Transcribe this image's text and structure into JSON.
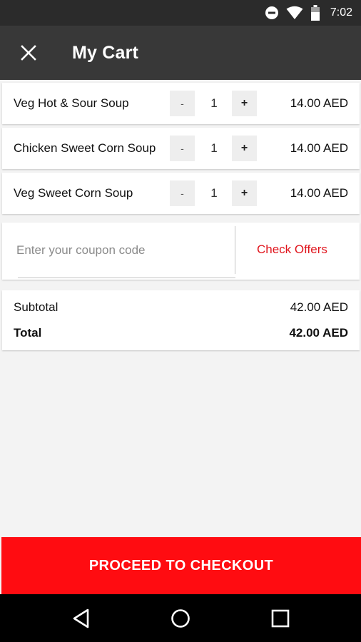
{
  "status_bar": {
    "time": "7:02"
  },
  "header": {
    "title": "My Cart"
  },
  "cart": {
    "items": [
      {
        "name": "Veg Hot & Sour Soup",
        "minus": "-",
        "qty": "1",
        "plus": "+",
        "price": "14.00 AED"
      },
      {
        "name": "Chicken Sweet Corn Soup",
        "minus": "-",
        "qty": "1",
        "plus": "+",
        "price": "14.00 AED"
      },
      {
        "name": "Veg Sweet Corn Soup",
        "minus": "-",
        "qty": "1",
        "plus": "+",
        "price": "14.00 AED"
      }
    ]
  },
  "coupon": {
    "placeholder": "Enter your coupon code",
    "value": "",
    "action": "Check Offers"
  },
  "totals": {
    "subtotal_label": "Subtotal",
    "subtotal_value": "42.00 AED",
    "total_label": "Total",
    "total_value": "42.00 AED"
  },
  "checkout": {
    "label": "PROCEED TO CHECKOUT"
  },
  "colors": {
    "accent": "#ff0c11",
    "link": "#e0141c",
    "app_bar": "#383838",
    "status_bar": "#2b2b2b"
  },
  "icons": {
    "status": [
      "do-not-disturb-icon",
      "wifi-icon",
      "battery-icon"
    ],
    "header": "close-icon",
    "nav": [
      "back-icon",
      "home-icon",
      "recents-icon"
    ]
  }
}
